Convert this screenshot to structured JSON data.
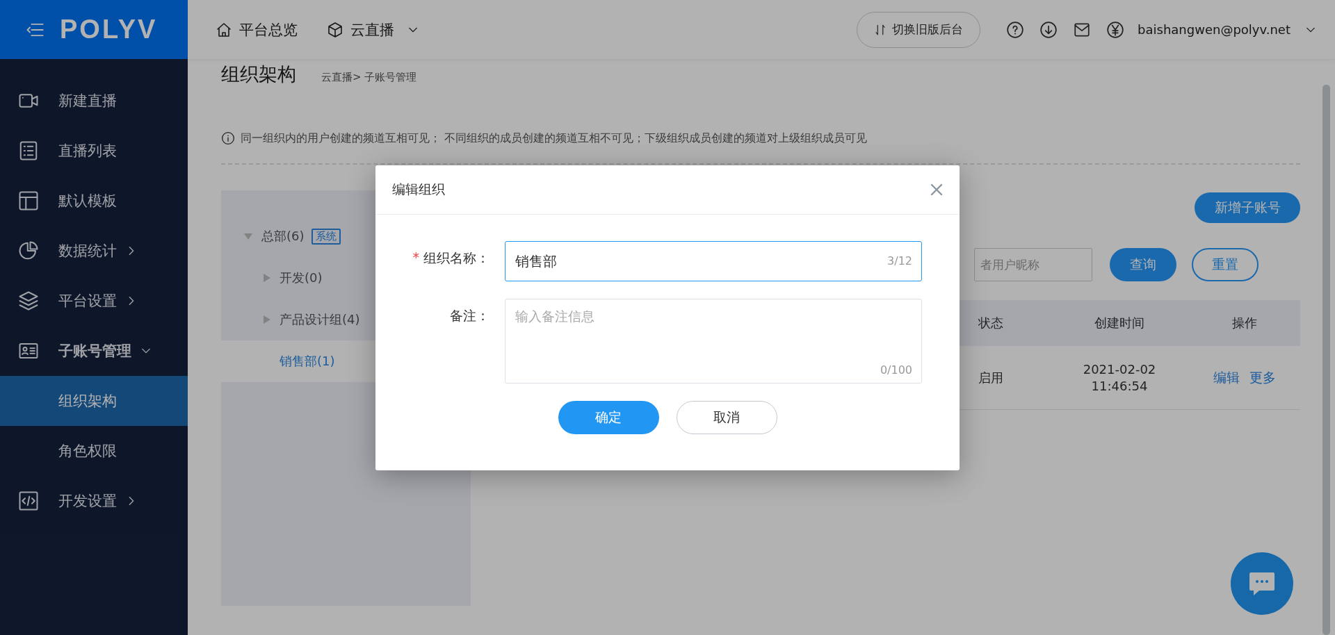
{
  "logo": {
    "text": "POLYV"
  },
  "top_nav": [
    {
      "label": "平台总览",
      "has_menu": false
    },
    {
      "label": "云直播",
      "has_menu": true
    }
  ],
  "switch_button": {
    "label": "切换旧版后台"
  },
  "user": {
    "email": "baishangwen@polyv.net"
  },
  "sidebar": {
    "items": [
      {
        "label": "新建直播",
        "selected": false,
        "has_submenu": false,
        "expanded": false
      },
      {
        "label": "直播列表",
        "selected": false,
        "has_submenu": false,
        "expanded": false
      },
      {
        "label": "默认模板",
        "selected": false,
        "has_submenu": false,
        "expanded": false
      },
      {
        "label": "数据统计",
        "selected": false,
        "has_submenu": true,
        "expanded": false
      },
      {
        "label": "平台设置",
        "selected": false,
        "has_submenu": true,
        "expanded": false
      },
      {
        "label": "子账号管理",
        "selected": false,
        "has_submenu": true,
        "expanded": true,
        "children": [
          {
            "label": "组织架构",
            "selected": true
          },
          {
            "label": "角色权限",
            "selected": false
          }
        ]
      },
      {
        "label": "开发设置",
        "selected": false,
        "has_submenu": true,
        "expanded": false
      }
    ]
  },
  "page": {
    "title": "组织架构",
    "breadcrumb": [
      "云直播",
      "子账号管理"
    ],
    "breadcrumb_separator": ">",
    "notice": "同一组织内的用户创建的频道互相可见； 不同组织的成员创建的频道互相不可见；下级组织成员创建的频道对上级组织成员可见"
  },
  "tree": [
    {
      "label": "总部(6)",
      "tag": "系统",
      "expanded": true,
      "has_children": true,
      "selected": false,
      "children": [
        {
          "label": "开发(0)",
          "expanded": false,
          "has_children": true,
          "selected": false
        },
        {
          "label": "产品设计组(4)",
          "expanded": false,
          "has_children": true,
          "selected": false
        },
        {
          "label": "销售部(1)",
          "expanded": false,
          "has_children": false,
          "selected": true
        }
      ]
    }
  ],
  "toolbar": {
    "add_button": "新增子账号",
    "search": {
      "placeholder": "者用户昵称"
    },
    "query_button": "查询",
    "reset_button": "重置"
  },
  "table": {
    "columns": [
      "状态",
      "创建时间",
      "操作"
    ],
    "rows": [
      {
        "status": "启用",
        "created": "2021-02-02 11:46:54",
        "actions": [
          "编辑",
          "更多"
        ]
      }
    ]
  },
  "modal": {
    "title": "编辑组织",
    "fields": [
      {
        "kind": "input",
        "label": "组织名称：",
        "required_mark": "*",
        "value": "销售部",
        "counter": "3/12",
        "focused": true
      },
      {
        "kind": "textarea",
        "label": "备注：",
        "placeholder": "输入备注信息",
        "counter": "0/100",
        "focused": false
      }
    ],
    "buttons": [
      {
        "label": "确定",
        "primary": true
      },
      {
        "label": "取消",
        "primary": false
      }
    ]
  }
}
